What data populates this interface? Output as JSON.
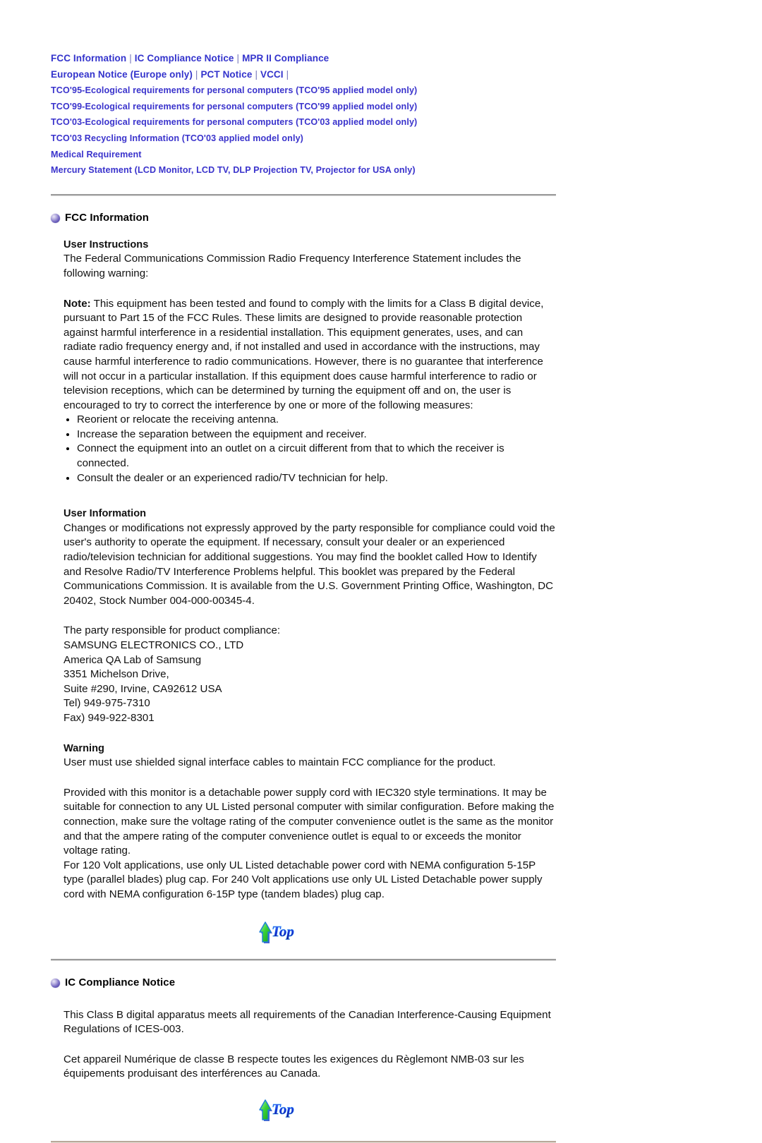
{
  "nav": {
    "row1": [
      {
        "label": "FCC Information",
        "bold": true
      },
      {
        "label": "IC Compliance Notice",
        "bold": true
      },
      {
        "label": "MPR II Compliance",
        "bold": true
      }
    ],
    "row2": [
      {
        "label": "European Notice (Europe only)",
        "bold": true
      },
      {
        "label": "PCT Notice",
        "bold": true
      },
      {
        "label": "VCCI",
        "bold": true
      }
    ],
    "rows_block": [
      "TCO'95-Ecological requirements for personal computers (TCO'95 applied model only)",
      "TCO'99-Ecological requirements for personal computers (TCO'99 applied model only)",
      "TCO'03-Ecological requirements for personal computers (TCO'03 applied model only)",
      "TCO'03 Recycling Information (TCO'03 applied model only)",
      "Medical Requirement",
      "Mercury Statement (LCD Monitor, LCD TV, DLP Projection TV, Projector for USA only)"
    ],
    "separator": "|",
    "link_color": "#3333CC"
  },
  "fcc": {
    "heading": "FCC Information",
    "user_instructions_heading": "User Instructions",
    "user_instructions_body": "The Federal Communications Commission Radio Frequency Interference Statement includes the following warning:",
    "note_label": "Note:",
    "note_body": " This equipment has been tested and found to comply with the limits for a Class B digital device, pursuant to Part 15 of the FCC Rules. These limits are designed to provide reasonable protection against harmful interference in a residential installation. This equipment generates, uses, and can radiate radio frequency energy and, if not installed and used in accordance with the instructions, may cause harmful interference to radio communications. However, there is no guarantee that interference will not occur in a particular installation. If this equipment does cause harmful interference to radio or television receptions, which can be determined by turning the equipment off and on, the user is encouraged to try to correct the interference by one or more of the following measures:",
    "measures": [
      "Reorient or relocate the receiving antenna.",
      "Increase the separation between the equipment and receiver.",
      "Connect the equipment into an outlet on a circuit different from that to which the receiver is connected.",
      "Consult the dealer or an experienced radio/TV technician for help."
    ],
    "user_information_heading": "User Information",
    "user_information_body": "Changes or modifications not expressly approved by the party responsible for compliance could void the user's authority to operate the equipment. If necessary, consult your dealer or an experienced radio/television technician for additional suggestions. You may find the booklet called How to Identify and Resolve Radio/TV Interference Problems helpful. This booklet was prepared by the Federal Communications Commission. It is available from the U.S. Government Printing Office, Washington, DC 20402, Stock Number 004-000-00345-4.",
    "responsible_party_lines": [
      "The party responsible for product compliance:",
      "SAMSUNG ELECTRONICS CO., LTD",
      "America QA Lab of Samsung",
      "3351 Michelson Drive,",
      "Suite #290, Irvine, CA92612 USA",
      "Tel) 949-975-7310",
      "Fax) 949-922-8301"
    ],
    "warning_heading": "Warning",
    "warning_body": "User must use shielded signal interface cables to maintain FCC compliance for the product.",
    "power_cord_body": "Provided with this monitor is a detachable power supply cord with IEC320 style terminations. It may be suitable for connection to any UL Listed personal computer with similar configuration. Before making the connection, make sure the voltage rating of the computer convenience outlet is the same as the monitor and that the ampere rating of the computer convenience outlet is equal to or exceeds the monitor voltage rating.",
    "power_cord_body2": "For 120 Volt applications, use only UL Listed detachable power cord with NEMA configuration 5-15P type (parallel blades) plug cap. For 240 Volt applications use only UL Listed Detachable power supply cord with NEMA configuration 6-15P type (tandem blades) plug cap."
  },
  "ic": {
    "heading": "IC Compliance Notice",
    "para_en": "This Class B digital apparatus meets all requirements of the Canadian Interference-Causing Equipment Regulations of ICES-003.",
    "para_fr": "Cet appareil Numérique de classe B respecte toutes les exigences du Règlemont NMB-03 sur les équipements produisant des interférences au Canada."
  },
  "top_button": {
    "label": "Top",
    "arrow_color": "#33CC33",
    "text_color": "#1A4FE0"
  }
}
